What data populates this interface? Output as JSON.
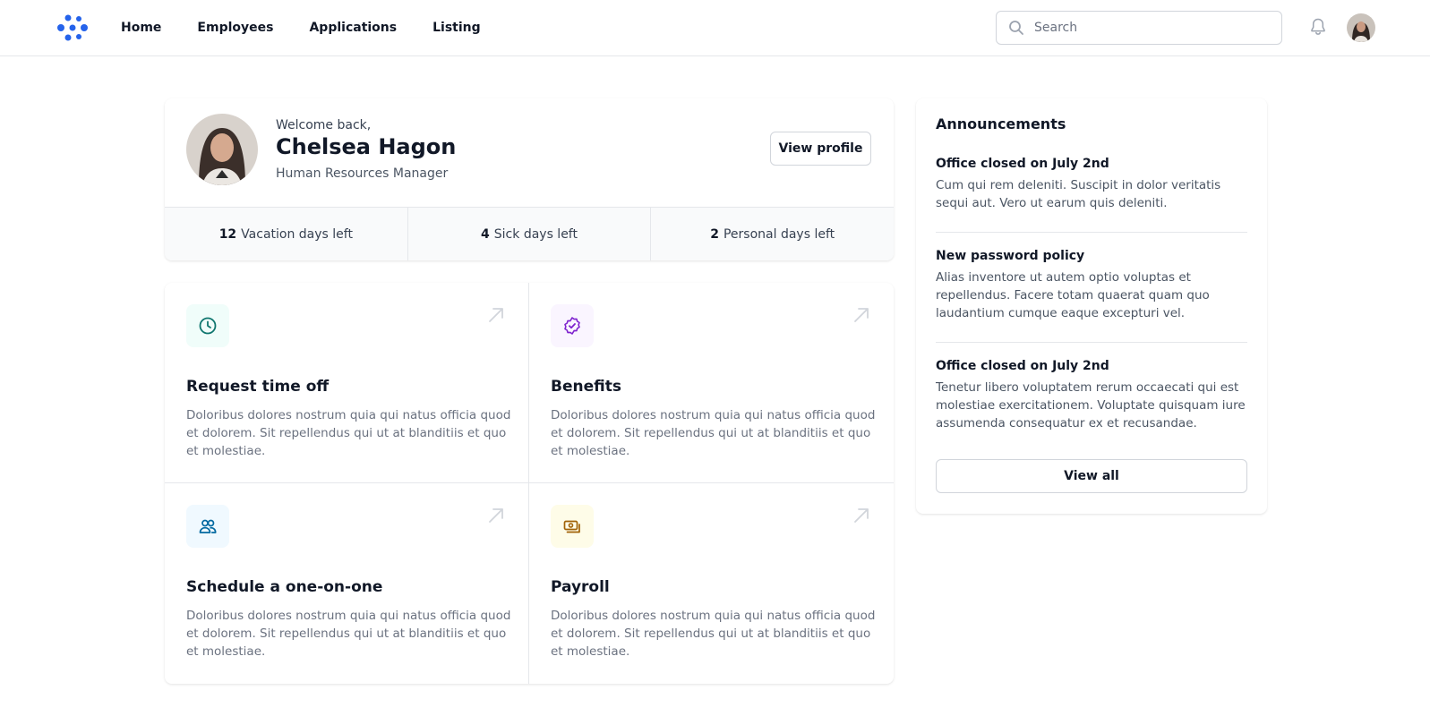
{
  "nav": {
    "items": [
      {
        "label": "Home"
      },
      {
        "label": "Employees"
      },
      {
        "label": "Applications"
      },
      {
        "label": "Listing"
      }
    ],
    "search_placeholder": "Search",
    "logo_icon": "dots-logo-icon",
    "bell_icon": "bell-icon"
  },
  "profile": {
    "welcome": "Welcome back,",
    "name": "Chelsea Hagon",
    "role": "Human Resources Manager",
    "view_profile_label": "View profile",
    "stats": [
      {
        "value": "12",
        "label": "Vacation days left"
      },
      {
        "value": "4",
        "label": "Sick days left"
      },
      {
        "value": "2",
        "label": "Personal days left"
      }
    ]
  },
  "actions": [
    {
      "title": "Request time off",
      "description": "Doloribus dolores nostrum quia qui natus officia quod et dolorem. Sit repellendus qui ut at blanditiis et quo et molestiae.",
      "icon": "clock-icon",
      "icon_color": "#0f766e",
      "icon_bg": "#f0fdfa"
    },
    {
      "title": "Benefits",
      "description": "Doloribus dolores nostrum quia qui natus officia quod et dolorem. Sit repellendus qui ut at blanditiis et quo et molestiae.",
      "icon": "check-badge-icon",
      "icon_color": "#7e22ce",
      "icon_bg": "#faf5ff"
    },
    {
      "title": "Schedule a one-on-one",
      "description": "Doloribus dolores nostrum quia qui natus officia quod et dolorem. Sit repellendus qui ut at blanditiis et quo et molestiae.",
      "icon": "users-icon",
      "icon_color": "#0369a1",
      "icon_bg": "#f0f9ff"
    },
    {
      "title": "Payroll",
      "description": "Doloribus dolores nostrum quia qui natus officia quod et dolorem. Sit repellendus qui ut at blanditiis et quo et molestiae.",
      "icon": "banknotes-icon",
      "icon_color": "#a16207",
      "icon_bg": "#fefce8"
    }
  ],
  "announcements": {
    "title": "Announcements",
    "items": [
      {
        "title": "Office closed on July 2nd",
        "body": "Cum qui rem deleniti. Suscipit in dolor veritatis sequi aut. Vero ut earum quis deleniti."
      },
      {
        "title": "New password policy",
        "body": "Alias inventore ut autem optio voluptas et repellendus. Facere totam quaerat quam quo laudantium cumque eaque excepturi vel."
      },
      {
        "title": "Office closed on July 2nd",
        "body": "Tenetur libero voluptatem rerum occaecati qui est molestiae exercitationem. Voluptate quisquam iure assumenda consequatur ex et recusandae."
      }
    ],
    "view_all_label": "View all"
  },
  "colors": {
    "brand": "#2563eb",
    "arrow": "#d1d5db"
  }
}
